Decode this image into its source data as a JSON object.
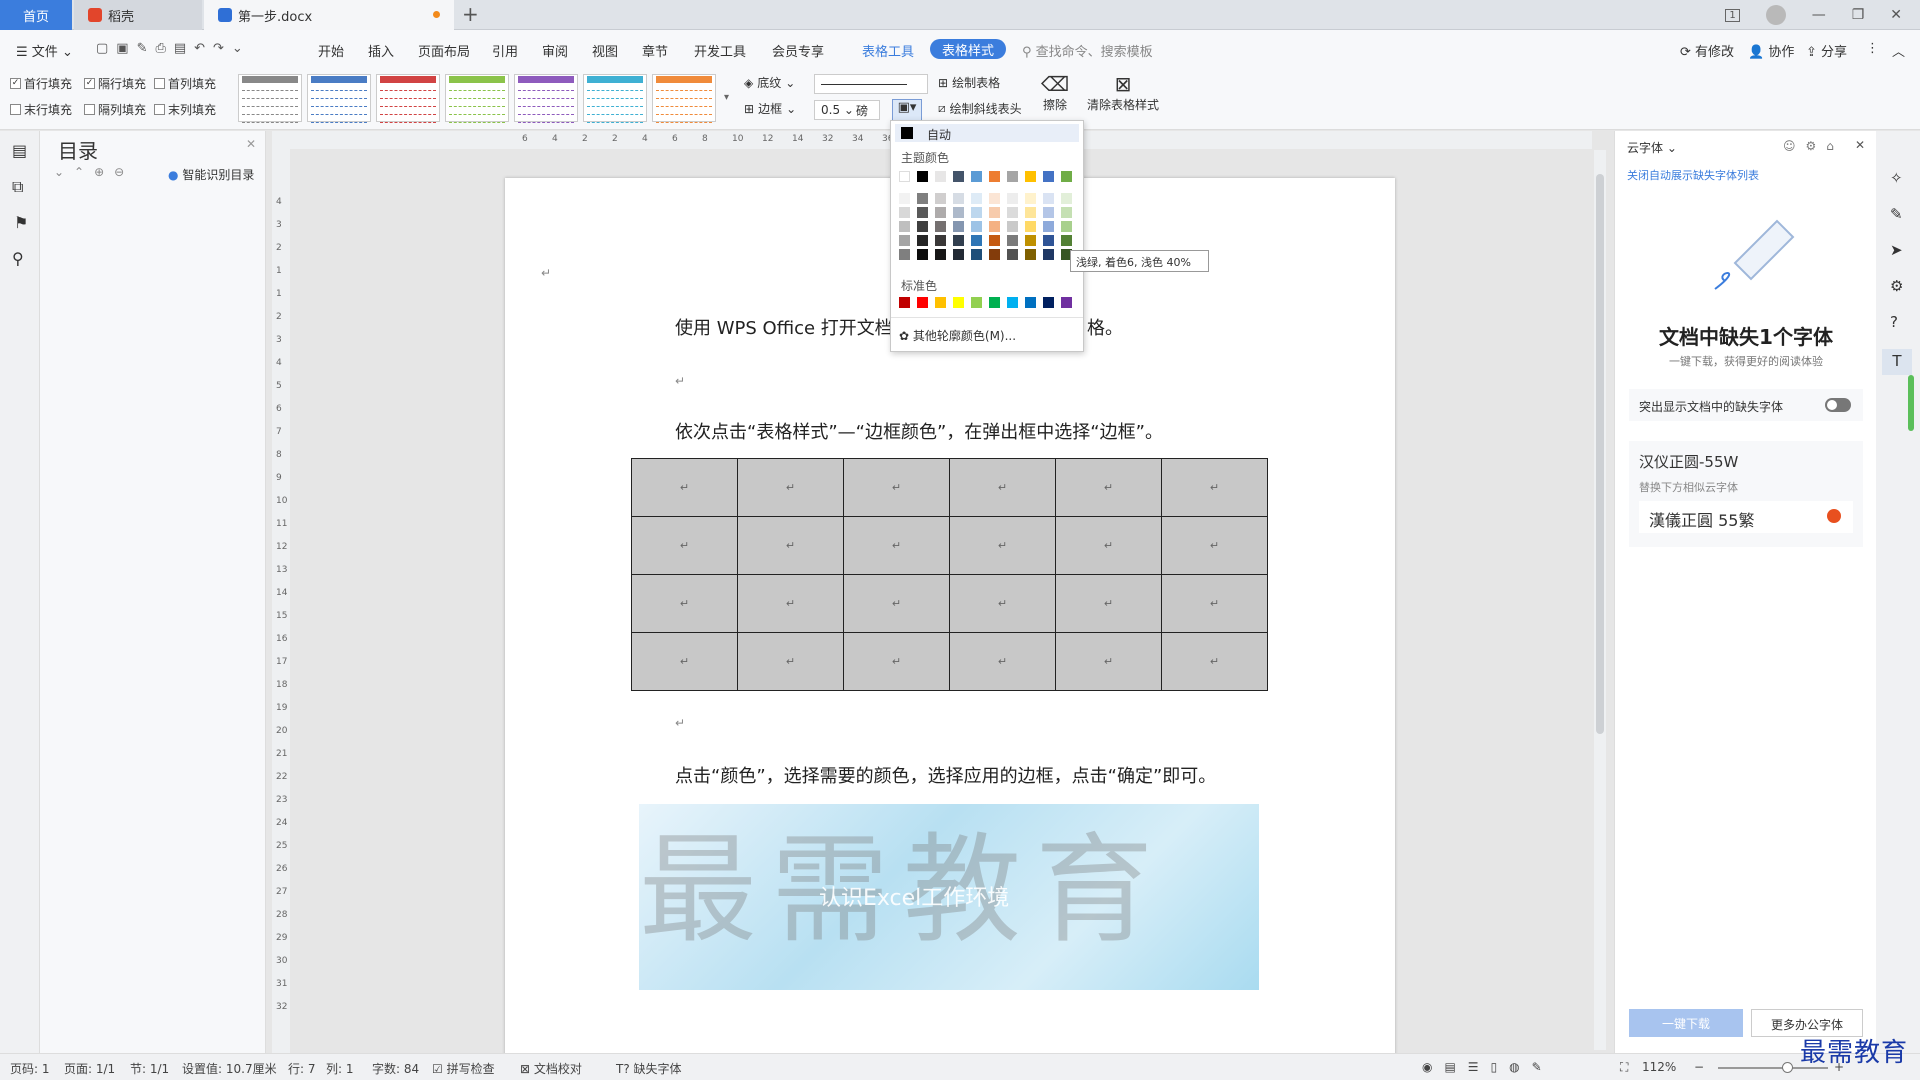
{
  "titlebar": {
    "tabs": [
      {
        "label": "首页"
      },
      {
        "label": "稻壳"
      },
      {
        "label": "第一步.docx"
      }
    ],
    "new_tab": "+",
    "badge": "1"
  },
  "menu": {
    "file": "文件",
    "items": [
      "开始",
      "插入",
      "页面布局",
      "引用",
      "审阅",
      "视图",
      "章节",
      "开发工具",
      "会员专享"
    ],
    "table_tools": "表格工具",
    "table_style": "表格样式",
    "search_placeholder": "查找命令、搜索模板",
    "right": {
      "changes": "有修改",
      "collab": "协作",
      "share": "分享"
    }
  },
  "ribbon": {
    "checks": [
      {
        "label": "首行填充",
        "checked": true
      },
      {
        "label": "隔行填充",
        "checked": true
      },
      {
        "label": "首列填充",
        "checked": false
      },
      {
        "label": "末行填充",
        "checked": false
      },
      {
        "label": "隔列填充",
        "checked": false
      },
      {
        "label": "末列填充",
        "checked": false
      }
    ],
    "shading": "底纹",
    "border": "边框",
    "line_width": "0.5",
    "line_unit": "磅",
    "draw_table": "绘制表格",
    "draw_diag": "绘制斜线表头",
    "erase": "擦除",
    "clear_style": "清除表格样式",
    "style_colors": [
      "#888888",
      "#4a7cc4",
      "#d14343",
      "#8bc34a",
      "#8e5bbd",
      "#3fb0d3",
      "#f08b3b"
    ]
  },
  "toc": {
    "title": "目录",
    "smart": "智能识别目录"
  },
  "ruler": {
    "h_ticks": [
      "6",
      "4",
      "2",
      "2",
      "4",
      "6",
      "8",
      "10",
      "12",
      "14",
      "32",
      "34",
      "36",
      "38",
      "40"
    ],
    "v_ticks": [
      "4",
      "3",
      "2",
      "1",
      "1",
      "2",
      "3",
      "4",
      "5",
      "6",
      "7",
      "8",
      "9",
      "10",
      "11",
      "12",
      "13",
      "14",
      "15",
      "16",
      "17",
      "18",
      "19",
      "20",
      "21",
      "22",
      "23",
      "24",
      "25",
      "26",
      "27",
      "28",
      "29",
      "30",
      "31",
      "32"
    ]
  },
  "document": {
    "para_mark": "↵",
    "line1": "使用 WPS Office 打开文档",
    "line1_tail": "格。",
    "line2": "依次点击“表格样式”—“边框颜色”，在弹出框中选择“边框”。",
    "line3": "点击“颜色”，选择需要的颜色，选择应用的边框，点击“确定”即可。",
    "table_rows": 4,
    "table_cols": 6,
    "banner_big": "最需教育",
    "banner_sub": "认识Excel工作环境"
  },
  "dropdown": {
    "auto": "自动",
    "theme_colors": "主题颜色",
    "standard_colors": "标准色",
    "more": "其他轮廓颜色(M)...",
    "theme_top": [
      "#ffffff",
      "#000000",
      "#e7e6e6",
      "#44546a",
      "#5b9bd5",
      "#ed7d31",
      "#a5a5a5",
      "#ffc000",
      "#4472c4",
      "#70ad47"
    ],
    "theme_shades": [
      [
        "#f2f2f2",
        "#7f7f7f",
        "#d0cece",
        "#d6dce4",
        "#deebf6",
        "#fbe5d5",
        "#ededed",
        "#fff2cc",
        "#dae3f3",
        "#e2efd9"
      ],
      [
        "#d8d8d8",
        "#595959",
        "#aeabab",
        "#adb9ca",
        "#bdd7ee",
        "#f7cbac",
        "#dbdbdb",
        "#fee599",
        "#b4c6e7",
        "#c5e0b3"
      ],
      [
        "#bfbfbf",
        "#3f3f3f",
        "#757070",
        "#8496b0",
        "#9dc3e6",
        "#f4b183",
        "#c9c9c9",
        "#ffd965",
        "#8eaadb",
        "#a8d08d"
      ],
      [
        "#a5a5a5",
        "#262626",
        "#3a3838",
        "#323f4f",
        "#2e75b5",
        "#c55a11",
        "#7b7b7b",
        "#bf9000",
        "#2f5496",
        "#538135"
      ],
      [
        "#7f7f7f",
        "#0c0c0c",
        "#171616",
        "#222a35",
        "#1e4e79",
        "#833c0b",
        "#525252",
        "#7f6000",
        "#1f3864",
        "#375623"
      ]
    ],
    "standard": [
      "#c00000",
      "#ff0000",
      "#ffc000",
      "#ffff00",
      "#92d050",
      "#00b050",
      "#00b0f0",
      "#0070c0",
      "#002060",
      "#7030a0"
    ],
    "tooltip": "浅绿, 着色6, 浅色 40%"
  },
  "right_panel": {
    "title": "云字体",
    "link": "关闭自动展示缺失字体列表",
    "heading": "文档中缺失1个字体",
    "sub": "一键下载，获得更好的阅读体验",
    "toggle_label": "突出显示文档中的缺失字体",
    "font_name": "汉仪正圆-55W",
    "replace_hint": "替换下方相似云字体",
    "font_sample": "漢儀正圓 55繁",
    "download_btn": "一键下载",
    "more_btn": "更多办公字体"
  },
  "status": {
    "page_num": "页码: 1",
    "pages": "页面: 1/1",
    "section": "节: 1/1",
    "setting": "设置值: 10.7厘米",
    "row": "行: 7",
    "col": "列: 1",
    "words": "字数: 84",
    "spell": "拼写检查",
    "proof": "文档校对",
    "missing": "缺失字体",
    "zoom": "112%"
  },
  "watermark": "最需教育"
}
